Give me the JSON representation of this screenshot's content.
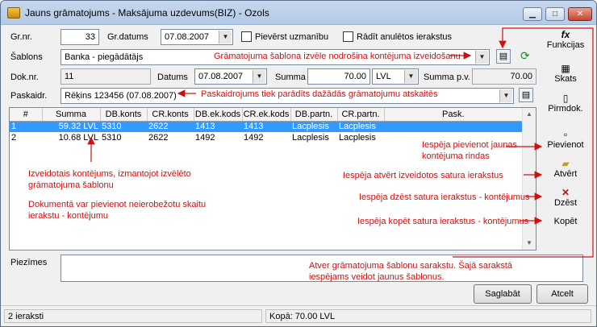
{
  "window": {
    "title": "Jauns grāmatojums - Maksājuma uzdevums(BIZ) - Ozols"
  },
  "header": {
    "gr_nr_label": "Gr.nr.",
    "gr_nr_value": "33",
    "gr_datums_label": "Gr.datums",
    "gr_datums_value": "07.08.2007",
    "pievērst_label": "Pievērst uzmanību",
    "rādīt_anulētos_label": "Rādīt anulētos ierakstus",
    "sablons_label": "Šablons",
    "sablons_value": "Banka - piegādātājs",
    "dok_nr_label": "Dok.nr.",
    "dok_nr_value": "11",
    "datums_label": "Datums",
    "datums_value": "07.08.2007",
    "summa_label": "Summa",
    "summa_value": "70.00",
    "currency_value": "LVL",
    "summa_pv_label": "Summa p.v.",
    "summa_pv_value": "70.00",
    "paskaidr_label": "Paskaidr.",
    "paskaidr_value": "Rēķins 123456 (07.08.2007)"
  },
  "grid": {
    "columns": [
      "#",
      "Summa",
      "DB.konts",
      "CR.konts",
      "DB.ek.kods",
      "CR.ek.kods",
      "DB.partn.",
      "CR.partn.",
      "Pask."
    ],
    "rows": [
      [
        "1",
        "59.32 LVL",
        "5310",
        "2622",
        "1413",
        "1413",
        "Lacplesis",
        "Lacplesis",
        ""
      ],
      [
        "2",
        "10.68 LVL",
        "5310",
        "2622",
        "1492",
        "1492",
        "Lacplesis",
        "Lacplesis",
        ""
      ]
    ]
  },
  "sidebar": {
    "funkcijas": "Funkcijas",
    "skats": "Skats",
    "pirmdok": "Pirmdok.",
    "pievienot": "Pievienot",
    "atvert": "Atvērt",
    "dzest": "Dzēst",
    "kopet": "Kopēt"
  },
  "piezimes_label": "Piezīmes",
  "buttons": {
    "saglabat": "Saglabāt",
    "atcelt": "Atcelt"
  },
  "status": {
    "left": "2 ieraksti",
    "right": "Kopā: 70.00 LVL"
  },
  "annotations": {
    "sablons": "Grāmatojuma šablona izvēle nodrošina kontējuma izveidošanu",
    "paskaidr": "Paskaidrojums tiek parādīts dažādās grāmatojumu atskaitēs",
    "izveidotais_1": "Izveidotais kontējums, izmantojot izvēlēto",
    "izveidotais_2": "grāmatojuma šablonu",
    "dokuments_1": "Dokumentā var pievienot neierobežotu skaitu",
    "dokuments_2": "ierakstu - kontējumu",
    "pievienot_1": "Iespēja pievienot jaunas",
    "pievienot_2": "kontējuma rindas",
    "atvert": "Iespēja atvērt izveidotos satura ierakstus",
    "dzest": "Iespēja dzēst satura ierakstus - kontējumus",
    "kopet": "Iespēja kopēt satura ierakstus - kontējumus",
    "atver_1": "Atver grāmatojuma šablonu sarakstu. Šajā sarakstā",
    "atver_2": "iespējams veidot jaunus šablonus."
  },
  "colors": {
    "annotation": "#d01010",
    "selection": "#3399ff"
  }
}
